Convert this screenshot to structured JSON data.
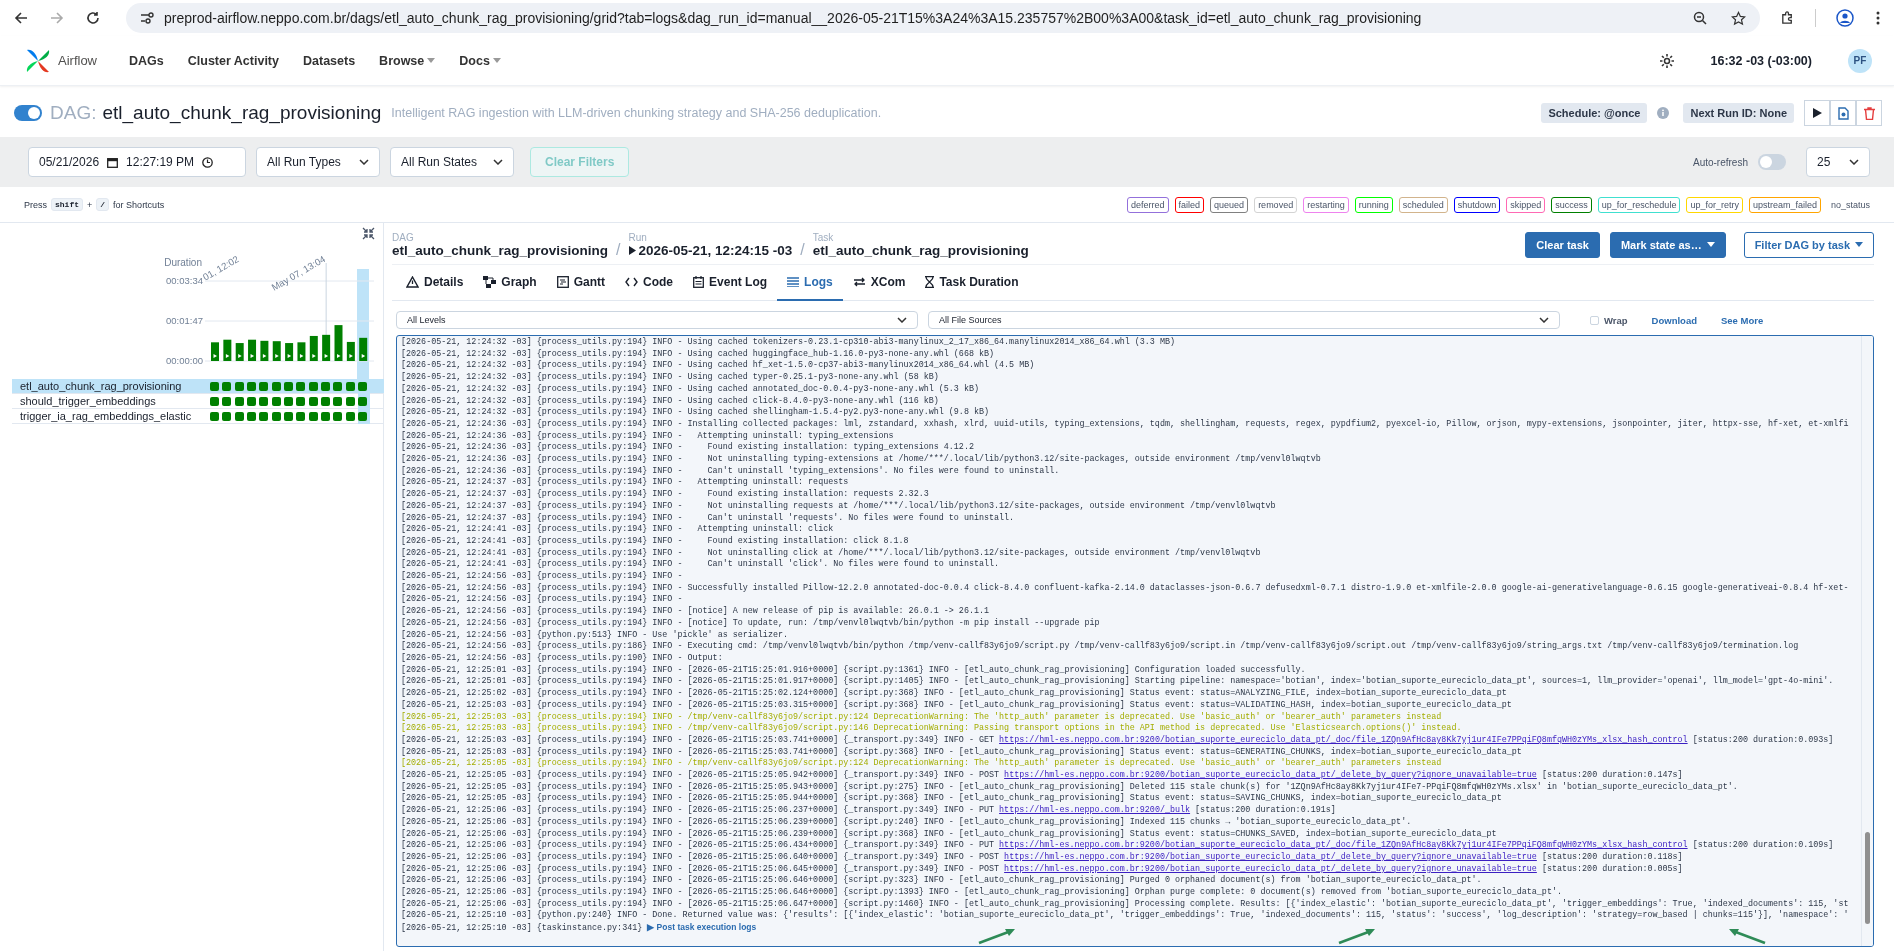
{
  "browser": {
    "url": "preprod-airflow.neppo.com.br/dags/etl_auto_chunk_rag_provisioning/grid?tab=logs&dag_run_id=manual__2026-05-21T15%3A24%3A15.235757%2B00%3A00&task_id=etl_auto_chunk_rag_provisioning"
  },
  "navbar": {
    "brand": "Airflow",
    "items": [
      {
        "label": "DAGs",
        "dropdown": false
      },
      {
        "label": "Cluster Activity",
        "dropdown": false
      },
      {
        "label": "Datasets",
        "dropdown": false
      },
      {
        "label": "Browse",
        "dropdown": true
      },
      {
        "label": "Docs",
        "dropdown": true
      }
    ],
    "time": "16:32 -03 (-03:00)",
    "avatar": "PF"
  },
  "dag": {
    "active": true,
    "prefix": "DAG:",
    "name": "etl_auto_chunk_rag_provisioning",
    "description": "Intelligent RAG ingestion with LLM-driven chunking strategy and SHA-256 deduplication.",
    "schedule": "Schedule: @once",
    "next_run": "Next Run ID: None"
  },
  "filters": {
    "date": "05/21/2026",
    "time": "12:27:19 PM",
    "run_types": "All Run Types",
    "run_states": "All Run States",
    "clear": {
      "label": "Clear Filters",
      "disabled": true
    },
    "auto_refresh": {
      "label": "Auto-refresh",
      "on": false
    },
    "page_size": "25"
  },
  "shortcuts": {
    "before": "Press",
    "key1": "shift",
    "plus": "+",
    "key2": "/",
    "after": "for Shortcuts"
  },
  "legend": [
    {
      "label": "deferred",
      "color": "#9370db"
    },
    {
      "label": "failed",
      "color": "#ff0000"
    },
    {
      "label": "queued",
      "color": "#808080"
    },
    {
      "label": "removed",
      "color": "#d3d3d3"
    },
    {
      "label": "restarting",
      "color": "#ee82ee"
    },
    {
      "label": "running",
      "color": "#00ff00"
    },
    {
      "label": "scheduled",
      "color": "#d2b48c"
    },
    {
      "label": "shutdown",
      "color": "#0000ff"
    },
    {
      "label": "skipped",
      "color": "#ff69b4"
    },
    {
      "label": "success",
      "color": "#008000"
    },
    {
      "label": "up_for_reschedule",
      "color": "#40e0d0"
    },
    {
      "label": "up_for_retry",
      "color": "#ffd700"
    },
    {
      "label": "upstream_failed",
      "color": "#ffa500"
    },
    {
      "label": "no_status"
    }
  ],
  "grid": {
    "date_labels": [
      "01, 12:02",
      "May 07, 13:04"
    ],
    "chart_data": {
      "type": "bar",
      "ylim": [
        0,
        214
      ],
      "yticks": [
        {
          "value": 0,
          "label": "00:00:00"
        },
        {
          "value": 107,
          "label": "00:01:47"
        },
        {
          "value": 214,
          "label": "00:03:34"
        }
      ],
      "series": [
        {
          "name": "Duration",
          "color": "#008000",
          "values": [
            50,
            57,
            48,
            57,
            54,
            53,
            48,
            50,
            67,
            70,
            96,
            51,
            62
          ]
        }
      ]
    },
    "runs": [
      {
        "selected": false
      },
      {
        "selected": false
      },
      {
        "selected": false
      },
      {
        "selected": false
      },
      {
        "selected": false
      },
      {
        "selected": false
      },
      {
        "selected": false
      },
      {
        "selected": false
      },
      {
        "selected": false
      },
      {
        "selected": false
      },
      {
        "selected": false
      },
      {
        "selected": false
      },
      {
        "selected": true
      }
    ],
    "tasks": [
      {
        "name": "etl_auto_chunk_rag_provisioning",
        "selected": true,
        "color": "#008000"
      },
      {
        "name": "should_trigger_embeddings",
        "selected": false,
        "color": "#008000"
      },
      {
        "name": "trigger_ia_rag_embeddings_elastic",
        "selected": false,
        "color": "#008000"
      }
    ]
  },
  "breadcrumb": [
    {
      "caption": "DAG",
      "value": "etl_auto_chunk_rag_provisioning",
      "run": false
    },
    {
      "separator": "/",
      "caption": "Run",
      "value": "2026-05-21, 12:24:15 -03",
      "run": true
    },
    {
      "separator": "/",
      "caption": "Task",
      "value": "etl_auto_chunk_rag_provisioning",
      "run": false
    }
  ],
  "actions": [
    {
      "label": "Clear task",
      "kind": "solid",
      "caret": false
    },
    {
      "label": "Mark state as…",
      "kind": "solid",
      "caret": true
    },
    {
      "label": "Filter DAG by task",
      "kind": "outline",
      "caret": true
    }
  ],
  "tabs": [
    {
      "label": "Details",
      "selected": false
    },
    {
      "label": "Graph",
      "selected": false
    },
    {
      "label": "Gantt",
      "selected": false
    },
    {
      "label": "Code",
      "selected": false
    },
    {
      "label": "Event Log",
      "selected": false
    },
    {
      "label": "Logs",
      "selected": true
    },
    {
      "label": "XCom",
      "selected": false
    },
    {
      "label": "Task Duration",
      "selected": false
    }
  ],
  "log_controls": {
    "levels": "All Levels",
    "sources": "All File Sources",
    "wrap": {
      "label": "Wrap",
      "checked": false
    },
    "download": "Download",
    "see_more": "See More"
  },
  "log": [
    {
      "kind": "info",
      "text": "[2026-05-21, 12:24:32 -03] {process_utils.py:194} INFO - Using cached tokenizers-0.23.1-cp310-abi3-manylinux_2_17_x86_64.manylinux2014_x86_64.whl (3.3 MB)"
    },
    {
      "kind": "info",
      "text": "[2026-05-21, 12:24:32 -03] {process_utils.py:194} INFO - Using cached huggingface_hub-1.16.0-py3-none-any.whl (668 kB)"
    },
    {
      "kind": "info",
      "text": "[2026-05-21, 12:24:32 -03] {process_utils.py:194} INFO - Using cached hf_xet-1.5.0-cp37-abi3-manylinux2014_x86_64.whl (4.5 MB)"
    },
    {
      "kind": "info",
      "text": "[2026-05-21, 12:24:32 -03] {process_utils.py:194} INFO - Using cached typer-0.25.1-py3-none-any.whl (58 kB)"
    },
    {
      "kind": "info",
      "text": "[2026-05-21, 12:24:32 -03] {process_utils.py:194} INFO - Using cached annotated_doc-0.0.4-py3-none-any.whl (5.3 kB)"
    },
    {
      "kind": "info",
      "text": "[2026-05-21, 12:24:32 -03] {process_utils.py:194} INFO - Using cached click-8.4.0-py3-none-any.whl (116 kB)"
    },
    {
      "kind": "info",
      "text": "[2026-05-21, 12:24:32 -03] {process_utils.py:194} INFO - Using cached shellingham-1.5.4-py2.py3-none-any.whl (9.8 kB)"
    },
    {
      "kind": "info",
      "text": "[2026-05-21, 12:24:36 -03] {process_utils.py:194} INFO - Installing collected packages: lml, zstandard, xxhash, xlrd, uuid-utils, typing_extensions, tqdm, shellingham, requests, regex, pypdfium2, pyexcel-io, Pillow, orjson, mypy-extensions, jsonpointer, jiter, httpx-sse, hf-xet, et-xmlfi"
    },
    {
      "kind": "info",
      "text": "[2026-05-21, 12:24:36 -03] {process_utils.py:194} INFO -   Attempting uninstall: typing_extensions"
    },
    {
      "kind": "info",
      "text": "[2026-05-21, 12:24:36 -03] {process_utils.py:194} INFO -     Found existing installation: typing_extensions 4.12.2"
    },
    {
      "kind": "info",
      "text": "[2026-05-21, 12:24:36 -03] {process_utils.py:194} INFO -     Not uninstalling typing-extensions at /home/***/.local/lib/python3.12/site-packages, outside environment /tmp/venvl0lwqtvb"
    },
    {
      "kind": "info",
      "text": "[2026-05-21, 12:24:36 -03] {process_utils.py:194} INFO -     Can't uninstall 'typing_extensions'. No files were found to uninstall."
    },
    {
      "kind": "info",
      "text": "[2026-05-21, 12:24:37 -03] {process_utils.py:194} INFO -   Attempting uninstall: requests"
    },
    {
      "kind": "info",
      "text": "[2026-05-21, 12:24:37 -03] {process_utils.py:194} INFO -     Found existing installation: requests 2.32.3"
    },
    {
      "kind": "info",
      "text": "[2026-05-21, 12:24:37 -03] {process_utils.py:194} INFO -     Not uninstalling requests at /home/***/.local/lib/python3.12/site-packages, outside environment /tmp/venvl0lwqtvb"
    },
    {
      "kind": "info",
      "text": "[2026-05-21, 12:24:37 -03] {process_utils.py:194} INFO -     Can't uninstall 'requests'. No files were found to uninstall."
    },
    {
      "kind": "info",
      "text": "[2026-05-21, 12:24:41 -03] {process_utils.py:194} INFO -   Attempting uninstall: click"
    },
    {
      "kind": "info",
      "text": "[2026-05-21, 12:24:41 -03] {process_utils.py:194} INFO -     Found existing installation: click 8.1.8"
    },
    {
      "kind": "info",
      "text": "[2026-05-21, 12:24:41 -03] {process_utils.py:194} INFO -     Not uninstalling click at /home/***/.local/lib/python3.12/site-packages, outside environment /tmp/venvl0lwqtvb"
    },
    {
      "kind": "info",
      "text": "[2026-05-21, 12:24:41 -03] {process_utils.py:194} INFO -     Can't uninstall 'click'. No files were found to uninstall."
    },
    {
      "kind": "info",
      "text": "[2026-05-21, 12:24:56 -03] {process_utils.py:194} INFO -"
    },
    {
      "kind": "info",
      "text": "[2026-05-21, 12:24:56 -03] {process_utils.py:194} INFO - Successfully installed Pillow-12.2.0 annotated-doc-0.0.4 click-8.4.0 confluent-kafka-2.14.0 dataclasses-json-0.6.7 defusedxml-0.7.1 distro-1.9.0 et-xmlfile-2.0.0 google-ai-generativelanguage-0.6.15 google-generativeai-0.8.4 hf-xet-"
    },
    {
      "kind": "info",
      "text": "[2026-05-21, 12:24:56 -03] {process_utils.py:194} INFO -"
    },
    {
      "kind": "info",
      "text": "[2026-05-21, 12:24:56 -03] {process_utils.py:194} INFO - [notice] A new release of pip is available: 26.0.1 -> 26.1.1"
    },
    {
      "kind": "info",
      "text": "[2026-05-21, 12:24:56 -03] {process_utils.py:194} INFO - [notice] To update, run: /tmp/venvl0lwqtvb/bin/python -m pip install --upgrade pip"
    },
    {
      "kind": "info",
      "text": "[2026-05-21, 12:24:56 -03] {python.py:513} INFO - Use 'pickle' as serializer."
    },
    {
      "kind": "info",
      "text": "[2026-05-21, 12:24:56 -03] {process_utils.py:186} INFO - Executing cmd: /tmp/venvl0lwqtvb/bin/python /tmp/venv-callf83y6jo9/script.py /tmp/venv-callf83y6jo9/script.in /tmp/venv-callf83y6jo9/script.out /tmp/venv-callf83y6jo9/string_args.txt /tmp/venv-callf83y6jo9/termination.log"
    },
    {
      "kind": "info",
      "text": "[2026-05-21, 12:24:56 -03] {process_utils.py:190} INFO - Output:"
    },
    {
      "kind": "info",
      "text": "[2026-05-21, 12:25:01 -03] {process_utils.py:194} INFO - [2026-05-21T15:25:01.916+0000] {script.py:1361} INFO - [etl_auto_chunk_rag_provisioning] Configuration loaded successfully."
    },
    {
      "kind": "info",
      "text": "[2026-05-21, 12:25:01 -03] {process_utils.py:194} INFO - [2026-05-21T15:25:01.917+0000] {script.py:1405} INFO - [etl_auto_chunk_rag_provisioning] Starting pipeline: namespace='botian', index='botian_suporte_eureciclo_data_pt', sources=1, llm_provider='openai', llm_model='gpt-4o-mini'."
    },
    {
      "kind": "info",
      "text": "[2026-05-21, 12:25:02 -03] {process_utils.py:194} INFO - [2026-05-21T15:25:02.124+0000] {script.py:368} INFO - [etl_auto_chunk_rag_provisioning] Status event: status=ANALYZING_FILE, index=botian_suporte_eureciclo_data_pt"
    },
    {
      "kind": "info",
      "text": "[2026-05-21, 12:25:03 -03] {process_utils.py:194} INFO - [2026-05-21T15:25:03.315+0000] {script.py:368} INFO - [etl_auto_chunk_rag_provisioning] Status event: status=VALIDATING_HASH, index=botian_suporte_eureciclo_data_pt"
    },
    {
      "kind": "warning",
      "text": "[2026-05-21, 12:25:03 -03] {process_utils.py:194} INFO - /tmp/venv-callf83y6jo9/script.py:124 DeprecationWarning: The 'http_auth' parameter is deprecated. Use 'basic_auth' or 'bearer_auth' parameters instead"
    },
    {
      "kind": "warning",
      "text": "[2026-05-21, 12:25:03 -03] {process_utils.py:194} INFO - /tmp/venv-callf83y6jo9/script.py:146 DeprecationWarning: Passing transport options in the API method is deprecated. Use 'Elasticsearch.options()' instead."
    },
    {
      "kind": "info",
      "text": "[2026-05-21, 12:25:03 -03] {process_utils.py:194} INFO - [2026-05-21T15:25:03.741+0000] {_transport.py:349} INFO - GET ",
      "link": "https://hml-es.neppo.com.br:9200/botian_suporte_eureciclo_data_pt/_doc/file_1ZQn9AfHc8ay8Kk7yj1ur4IFe7PPqiFQ8mfqWH0zYMs_xlsx_hash_control",
      "after": " [status:200 duration:0.093s]"
    },
    {
      "kind": "info",
      "text": "[2026-05-21, 12:25:03 -03] {process_utils.py:194} INFO - [2026-05-21T15:25:03.741+0000] {script.py:368} INFO - [etl_auto_chunk_rag_provisioning] Status event: status=GENERATING_CHUNKS, index=botian_suporte_eureciclo_data_pt"
    },
    {
      "kind": "warning",
      "text": "[2026-05-21, 12:25:05 -03] {process_utils.py:194} INFO - /tmp/venv-callf83y6jo9/script.py:124 DeprecationWarning: The 'http_auth' parameter is deprecated. Use 'basic_auth' or 'bearer_auth' parameters instead"
    },
    {
      "kind": "info",
      "text": "[2026-05-21, 12:25:05 -03] {process_utils.py:194} INFO - [2026-05-21T15:25:05.942+0000] {_transport.py:349} INFO - POST ",
      "link": "https://hml-es.neppo.com.br:9200/botian_suporte_eureciclo_data_pt/_delete_by_query?ignore_unavailable=true",
      "after": " [status:200 duration:0.147s]"
    },
    {
      "kind": "info",
      "text": "[2026-05-21, 12:25:05 -03] {process_utils.py:194} INFO - [2026-05-21T15:25:05.943+0000] {script.py:275} INFO - [etl_auto_chunk_rag_provisioning] Deleted 115 stale chunk(s) for '1ZQn9AfHc8ay8Kk7yj1ur4IFe7-PPqiFQ8mfqWH0zYMs.xlsx' in 'botian_suporte_eureciclo_data_pt'."
    },
    {
      "kind": "info",
      "text": "[2026-05-21, 12:25:05 -03] {process_utils.py:194} INFO - [2026-05-21T15:25:05.944+0000] {script.py:368} INFO - [etl_auto_chunk_rag_provisioning] Status event: status=SAVING_CHUNKS, index=botian_suporte_eureciclo_data_pt"
    },
    {
      "kind": "info",
      "text": "[2026-05-21, 12:25:06 -03] {process_utils.py:194} INFO - [2026-05-21T15:25:06.237+0000] {_transport.py:349} INFO - PUT ",
      "link": "https://hml-es.neppo.com.br:9200/_bulk",
      "after": " [status:200 duration:0.191s]"
    },
    {
      "kind": "info",
      "text": "[2026-05-21, 12:25:06 -03] {process_utils.py:194} INFO - [2026-05-21T15:25:06.239+0000] {script.py:240} INFO - [etl_auto_chunk_rag_provisioning] Indexed 115 chunks → 'botian_suporte_eureciclo_data_pt'."
    },
    {
      "kind": "info",
      "text": "[2026-05-21, 12:25:06 -03] {process_utils.py:194} INFO - [2026-05-21T15:25:06.239+0000] {script.py:368} INFO - [etl_auto_chunk_rag_provisioning] Status event: status=CHUNKS_SAVED, index=botian_suporte_eureciclo_data_pt"
    },
    {
      "kind": "info",
      "text": "[2026-05-21, 12:25:06 -03] {process_utils.py:194} INFO - [2026-05-21T15:25:06.434+0000] {_transport.py:349} INFO - PUT ",
      "link": "https://hml-es.neppo.com.br:9200/botian_suporte_eureciclo_data_pt/_doc/file_1ZQn9AfHc8ay8Kk7yj1ur4IFe7PPqiFQ8mfqWH0zYMs_xlsx_hash_control",
      "after": " [status:200 duration:0.109s]"
    },
    {
      "kind": "info",
      "text": "[2026-05-21, 12:25:06 -03] {process_utils.py:194} INFO - [2026-05-21T15:25:06.640+0000] {_transport.py:349} INFO - POST ",
      "link": "https://hml-es.neppo.com.br:9200/botian_suporte_eureciclo_data_pt/_delete_by_query?ignore_unavailable=true",
      "after": " [status:200 duration:0.118s]"
    },
    {
      "kind": "info",
      "text": "[2026-05-21, 12:25:06 -03] {process_utils.py:194} INFO - [2026-05-21T15:25:06.645+0000] {_transport.py:349} INFO - POST ",
      "link": "https://hml-es.neppo.com.br:9200/botian_suporte_eureciclo_data_pt/_delete_by_query?ignore_unavailable=true",
      "after": " [status:200 duration:0.005s]"
    },
    {
      "kind": "info",
      "text": "[2026-05-21, 12:25:06 -03] {process_utils.py:194} INFO - [2026-05-21T15:25:06.646+0000] {script.py:323} INFO - [etl_auto_chunk_rag_provisioning] Purged 0 orphaned document(s) from 'botian_suporte_eureciclo_data_pt'."
    },
    {
      "kind": "info",
      "text": "[2026-05-21, 12:25:06 -03] {process_utils.py:194} INFO - [2026-05-21T15:25:06.646+0000] {script.py:1393} INFO - [etl_auto_chunk_rag_provisioning] Orphan purge complete: 0 document(s) removed from 'botian_suporte_eureciclo_data_pt'."
    },
    {
      "kind": "info",
      "text": "[2026-05-21, 12:25:06 -03] {process_utils.py:194} INFO - [2026-05-21T15:25:06.647+0000] {script.py:1460} INFO - [etl_auto_chunk_rag_provisioning] Processing complete. Results: [{'index_elastic': 'botian_suporte_eureciclo_data_pt', 'trigger_embeddings': True, 'indexed_documents': 115, 'st"
    },
    {
      "kind": "info",
      "text": "[2026-05-21, 12:25:10 -03] {python.py:240} INFO - Done. Returned value was: {'results': [{'index_elastic': 'botian_suporte_eureciclo_data_pt', 'trigger_embeddings': True, 'indexed_documents': 115, 'status': 'success', 'log_description': 'strategy=row_based | chunks=115'}], 'namespace': '"
    },
    {
      "kind": "group",
      "text": "[2026-05-21, 12:25:10 -03] {taskinstance.py:341}",
      "toggle": "▶",
      "label": "Post task execution logs"
    }
  ]
}
